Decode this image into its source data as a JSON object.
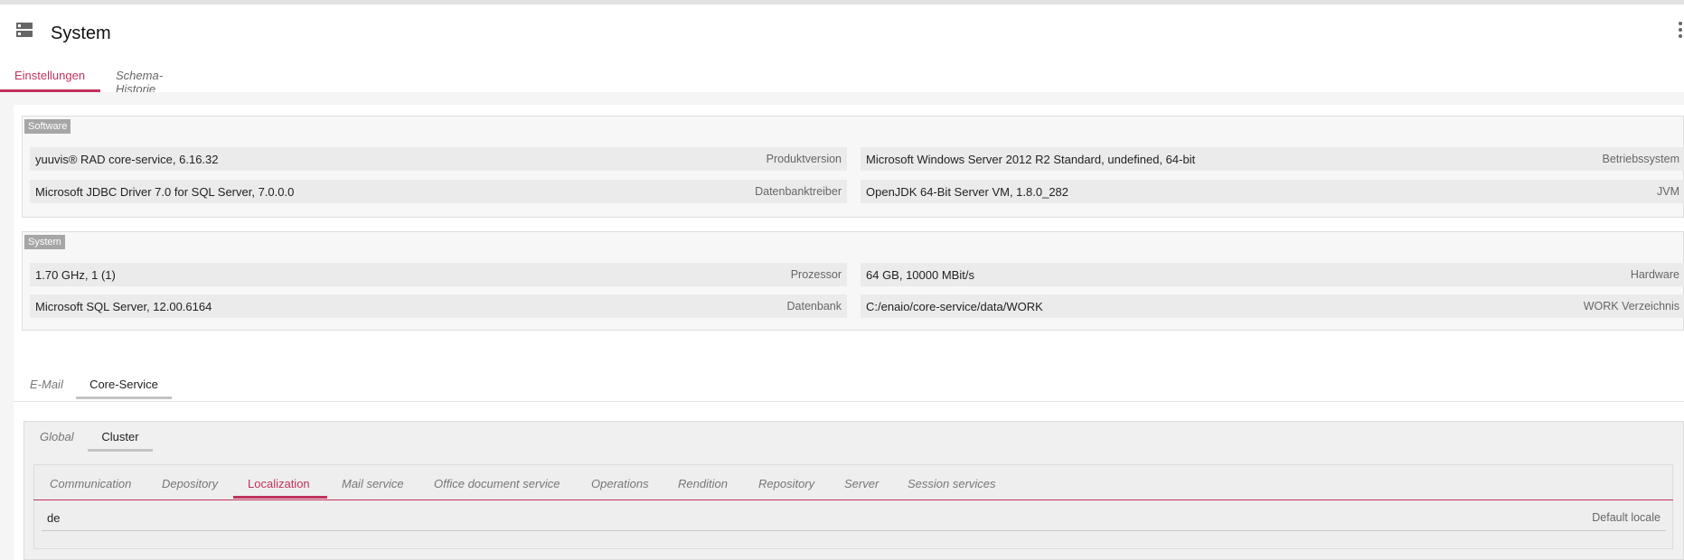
{
  "header": {
    "app_icon": "server-icon",
    "title": "System",
    "menu_icon": "kebab-menu-icon"
  },
  "main_tabs": [
    {
      "label": "Einstellungen",
      "active": true
    },
    {
      "label": "Schema-Historie",
      "active": false
    }
  ],
  "sections": {
    "software": {
      "label": "Software",
      "fields": [
        {
          "value": "yuuvis® RAD core-service, 6.16.32",
          "label": "Produktversion"
        },
        {
          "value": "Microsoft Windows Server 2012 R2 Standard, undefined, 64-bit",
          "label": "Betriebssystem"
        },
        {
          "value": "Microsoft JDBC Driver 7.0 for SQL Server, 7.0.0.0",
          "label": "Datenbanktreiber"
        },
        {
          "value": "OpenJDK 64-Bit Server VM, 1.8.0_282",
          "label": "JVM"
        }
      ]
    },
    "system": {
      "label": "System",
      "fields": [
        {
          "value": "1.70 GHz, 1 (1)",
          "label": "Prozessor"
        },
        {
          "value": "64 GB, 10000 MBit/s",
          "label": "Hardware"
        },
        {
          "value": "Microsoft SQL Server, 12.00.6164",
          "label": "Datenbank"
        },
        {
          "value": "C:/enaio/core-service/data/WORK",
          "label": "WORK Verzeichnis"
        }
      ]
    }
  },
  "service_tabs": [
    {
      "label": "E-Mail",
      "active": false
    },
    {
      "label": "Core-Service",
      "active": true
    }
  ],
  "scope_tabs": [
    {
      "label": "Global",
      "active": false
    },
    {
      "label": "Cluster",
      "active": true
    }
  ],
  "category_tabs": [
    {
      "label": "Communication",
      "active": false
    },
    {
      "label": "Depository",
      "active": false
    },
    {
      "label": "Localization",
      "active": true
    },
    {
      "label": "Mail service",
      "active": false
    },
    {
      "label": "Office document service",
      "active": false
    },
    {
      "label": "Operations",
      "active": false
    },
    {
      "label": "Rendition",
      "active": false
    },
    {
      "label": "Repository",
      "active": false
    },
    {
      "label": "Server",
      "active": false
    },
    {
      "label": "Session services",
      "active": false
    }
  ],
  "localization": {
    "value": "de",
    "label": "Default locale"
  },
  "colors": {
    "accent": "#c0335c",
    "section_label_bg": "#a6a6a6",
    "field_bg": "#ebebeb"
  }
}
